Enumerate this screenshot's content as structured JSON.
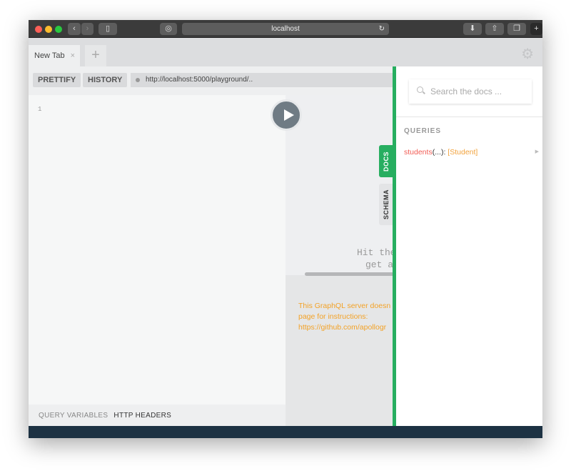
{
  "browser": {
    "address": "localhost"
  },
  "tabs": [
    {
      "label": "New Tab"
    }
  ],
  "toolbar": {
    "prettify": "PRETTIFY",
    "history": "HISTORY",
    "endpoint": "http://localhost:5000/playground/.."
  },
  "editor": {
    "line_number": "1"
  },
  "bottom_tabs": {
    "query_variables": "QUERY VARIABLES",
    "http_headers": "HTTP HEADERS"
  },
  "result": {
    "hint_line1": "Hit the",
    "hint_line2": "get a",
    "warning_line1": "This GraphQL server doesn",
    "warning_line2": "page for instructions:",
    "warning_line3": "https://github.com/apollogr"
  },
  "side_tabs": {
    "docs": "DOCS",
    "schema": "SCHEMA"
  },
  "docs": {
    "search_placeholder": "Search the docs ...",
    "section": "QUERIES",
    "field_name": "students",
    "field_args": "(...)",
    "field_colon": ": ",
    "field_type": "[Student]"
  },
  "colors": {
    "accent": "#27ae60",
    "field": "#f25c54",
    "type": "#f2a23c",
    "warning": "#f3a227",
    "footer": "#1d3243"
  }
}
